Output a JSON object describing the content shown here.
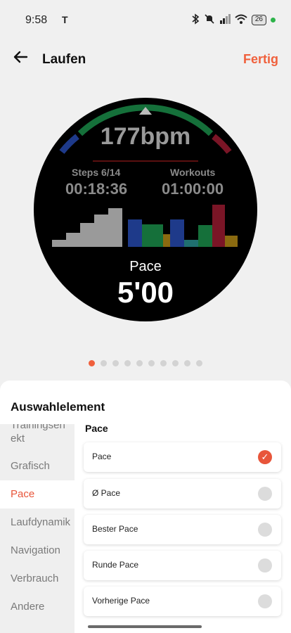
{
  "status": {
    "time": "9:58",
    "app_glyph": "T",
    "battery": "26"
  },
  "header": {
    "title": "Laufen",
    "done_label": "Fertig"
  },
  "watch": {
    "heart_rate": "177bpm",
    "steps_label": "Steps 6/14",
    "steps_time": "00:18:36",
    "workouts_label": "Workouts",
    "workouts_time": "01:00:00",
    "pace_label": "Pace",
    "pace_value": "5'00",
    "colors": {
      "gray": "#9a9a9a",
      "blue": "#1e3a8a",
      "green": "#15703a",
      "olive": "#8a6a10",
      "teal": "#1f6f6f",
      "red": "#7a1526"
    }
  },
  "pager": {
    "count": 10,
    "active_index": 0
  },
  "sheet": {
    "title": "Auswahlelement",
    "side_top": "Trainingsen\nekt",
    "side_items": [
      "Grafisch",
      "Pace",
      "Laufdynamik",
      "Navigation",
      "Verbrauch",
      "Andere"
    ],
    "active_side": "Pace",
    "content_title": "Pace",
    "options": [
      {
        "label": "Pace",
        "selected": true
      },
      {
        "label": "Ø Pace",
        "selected": false
      },
      {
        "label": "Bester Pace",
        "selected": false
      },
      {
        "label": "Runde Pace",
        "selected": false
      },
      {
        "label": "Vorherige Pace",
        "selected": false
      }
    ],
    "accent": "#e8553a"
  }
}
